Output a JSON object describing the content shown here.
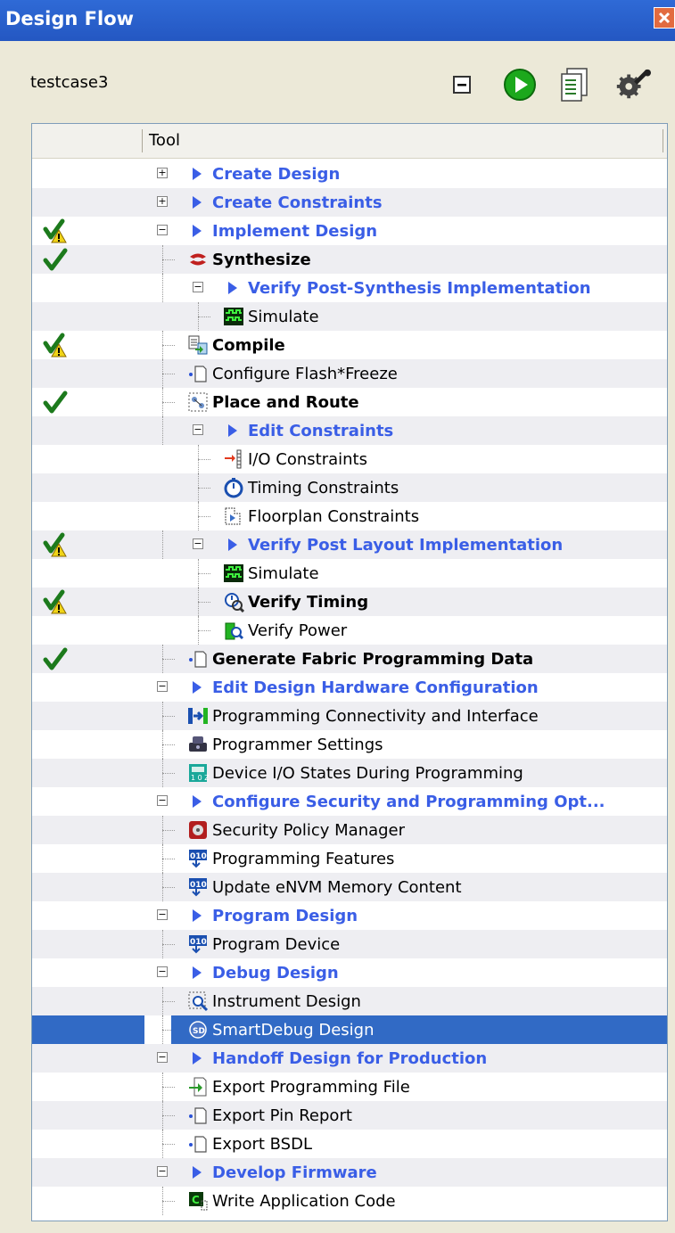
{
  "window": {
    "title": "Design Flow"
  },
  "project": {
    "name": "testcase3"
  },
  "toolbar": {
    "icons": [
      "collapse-icon",
      "run-icon",
      "report-icon",
      "settings-icon"
    ]
  },
  "table": {
    "column_tool": "Tool"
  },
  "tree": [
    {
      "label": "Create Design",
      "style": "group",
      "level": 0,
      "expander": "plus",
      "status": ""
    },
    {
      "label": "Create Constraints",
      "style": "group",
      "level": 0,
      "expander": "plus",
      "status": ""
    },
    {
      "label": "Implement Design",
      "style": "group",
      "level": 0,
      "expander": "minus",
      "status": "warning"
    },
    {
      "label": "Synthesize",
      "style": "bold",
      "level": 1,
      "icon": "synthesize-icon",
      "status": "check"
    },
    {
      "label": "Verify Post-Synthesis Implementation",
      "style": "group",
      "level": 1,
      "expander": "minus",
      "status": ""
    },
    {
      "label": "Simulate",
      "style": "normal",
      "level": 2,
      "icon": "simulate-icon",
      "status": ""
    },
    {
      "label": "Compile",
      "style": "bold",
      "level": 1,
      "icon": "compile-icon",
      "status": "warning"
    },
    {
      "label": "Configure Flash*Freeze",
      "style": "normal",
      "level": 1,
      "icon": "page-icon",
      "status": ""
    },
    {
      "label": "Place and Route",
      "style": "bold",
      "level": 1,
      "icon": "place-route-icon",
      "status": "check"
    },
    {
      "label": "Edit Constraints",
      "style": "group",
      "level": 1,
      "expander": "minus",
      "status": ""
    },
    {
      "label": "I/O Constraints",
      "style": "normal",
      "level": 2,
      "icon": "io-constraints-icon",
      "status": ""
    },
    {
      "label": "Timing Constraints",
      "style": "normal",
      "level": 2,
      "icon": "timer-icon",
      "status": ""
    },
    {
      "label": "Floorplan Constraints",
      "style": "normal",
      "level": 2,
      "icon": "floorplan-icon",
      "status": ""
    },
    {
      "label": "Verify Post Layout Implementation",
      "style": "group",
      "level": 1,
      "expander": "minus",
      "status": "warning"
    },
    {
      "label": "Simulate",
      "style": "normal",
      "level": 2,
      "icon": "simulate-icon",
      "status": ""
    },
    {
      "label": "Verify Timing",
      "style": "bold",
      "level": 2,
      "icon": "verify-timing-icon",
      "status": "warning"
    },
    {
      "label": "Verify Power",
      "style": "normal",
      "level": 2,
      "icon": "verify-power-icon",
      "status": ""
    },
    {
      "label": "Generate Fabric Programming Data",
      "style": "bold",
      "level": 1,
      "icon": "page-icon",
      "status": "check"
    },
    {
      "label": "Edit Design Hardware Configuration",
      "style": "group",
      "level": 0,
      "expander": "minus",
      "status": ""
    },
    {
      "label": "Programming Connectivity and Interface",
      "style": "normal",
      "level": 1,
      "icon": "connectivity-icon",
      "status": ""
    },
    {
      "label": "Programmer Settings",
      "style": "normal",
      "level": 1,
      "icon": "programmer-icon",
      "status": ""
    },
    {
      "label": "Device I/O States During Programming",
      "style": "normal",
      "level": 1,
      "icon": "io-states-icon",
      "status": ""
    },
    {
      "label": "Configure Security and Programming Opt...",
      "style": "group",
      "level": 0,
      "expander": "minus",
      "status": ""
    },
    {
      "label": "Security Policy Manager",
      "style": "normal",
      "level": 1,
      "icon": "security-icon",
      "status": ""
    },
    {
      "label": "Programming Features",
      "style": "normal",
      "level": 1,
      "icon": "binary-icon",
      "status": ""
    },
    {
      "label": "Update eNVM Memory Content",
      "style": "normal",
      "level": 1,
      "icon": "binary-icon",
      "status": ""
    },
    {
      "label": "Program Design",
      "style": "group",
      "level": 0,
      "expander": "minus",
      "status": ""
    },
    {
      "label": "Program Device",
      "style": "normal",
      "level": 1,
      "icon": "binary-icon",
      "status": ""
    },
    {
      "label": "Debug Design",
      "style": "group",
      "level": 0,
      "expander": "minus",
      "status": ""
    },
    {
      "label": "Instrument Design",
      "style": "normal",
      "level": 1,
      "icon": "instrument-icon",
      "status": ""
    },
    {
      "label": "SmartDebug Design",
      "style": "normal",
      "level": 1,
      "icon": "smartdebug-icon",
      "status": "",
      "selected": true
    },
    {
      "label": "Handoff Design for Production",
      "style": "group",
      "level": 0,
      "expander": "minus",
      "status": ""
    },
    {
      "label": "Export Programming File",
      "style": "normal",
      "level": 1,
      "icon": "export-icon",
      "status": ""
    },
    {
      "label": "Export Pin Report",
      "style": "normal",
      "level": 1,
      "icon": "page-icon",
      "status": ""
    },
    {
      "label": "Export BSDL",
      "style": "normal",
      "level": 1,
      "icon": "page-icon",
      "status": ""
    },
    {
      "label": "Develop Firmware",
      "style": "group",
      "level": 0,
      "expander": "minus",
      "status": ""
    },
    {
      "label": "Write Application Code",
      "style": "normal",
      "level": 1,
      "icon": "code-icon",
      "status": ""
    }
  ]
}
